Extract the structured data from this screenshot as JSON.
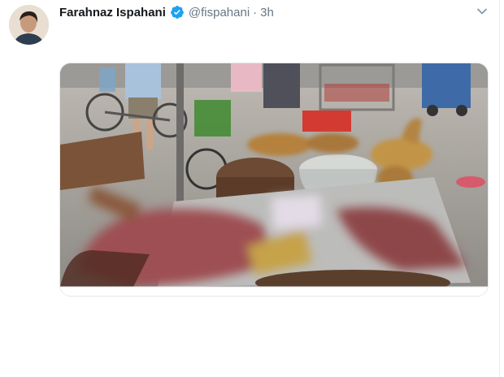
{
  "tweet": {
    "author_name": "Farahnaz Ispahani",
    "handle": "@fispahani",
    "separator": "·",
    "time": "3h",
    "icons": {
      "verified": "verified-badge-icon",
      "menu": "chevron-down-icon"
    },
    "colors": {
      "verified": "#1da1f2",
      "muted": "#657786",
      "name": "#14171a"
    }
  }
}
